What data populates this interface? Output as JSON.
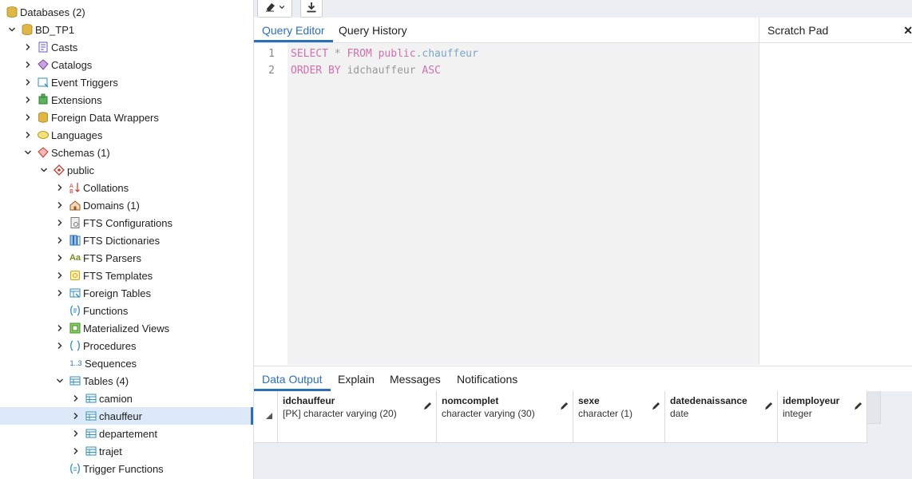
{
  "tree": {
    "items": [
      {
        "label": "Databases (2)",
        "icon": "databases-icon"
      },
      {
        "label": "BD_TP1",
        "icon": "database-icon"
      },
      {
        "label": "Casts",
        "icon": "casts-icon"
      },
      {
        "label": "Catalogs",
        "icon": "catalogs-icon"
      },
      {
        "label": "Event Triggers",
        "icon": "event-triggers-icon"
      },
      {
        "label": "Extensions",
        "icon": "extensions-icon"
      },
      {
        "label": "Foreign Data Wrappers",
        "icon": "foreign-data-wrappers-icon"
      },
      {
        "label": "Languages",
        "icon": "languages-icon"
      },
      {
        "label": "Schemas (1)",
        "icon": "schemas-icon"
      },
      {
        "label": "public",
        "icon": "schema-icon"
      },
      {
        "label": "Collations",
        "icon": "collations-icon"
      },
      {
        "label": "Domains (1)",
        "icon": "domains-icon"
      },
      {
        "label": "FTS Configurations",
        "icon": "fts-configurations-icon"
      },
      {
        "label": "FTS Dictionaries",
        "icon": "fts-dictionaries-icon"
      },
      {
        "label": "FTS Parsers",
        "icon": "fts-parsers-icon",
        "glyph": "Aa"
      },
      {
        "label": "FTS Templates",
        "icon": "fts-templates-icon"
      },
      {
        "label": "Foreign Tables",
        "icon": "foreign-tables-icon"
      },
      {
        "label": "Functions",
        "icon": "functions-icon"
      },
      {
        "label": "Materialized Views",
        "icon": "materialized-views-icon"
      },
      {
        "label": "Procedures",
        "icon": "procedures-icon"
      },
      {
        "label": "Sequences",
        "icon": "sequences-icon",
        "glyph": "1..3"
      },
      {
        "label": "Tables (4)",
        "icon": "tables-icon"
      },
      {
        "label": "camion",
        "icon": "table-icon"
      },
      {
        "label": "chauffeur",
        "icon": "table-icon"
      },
      {
        "label": "departement",
        "icon": "table-icon"
      },
      {
        "label": "trajet",
        "icon": "table-icon"
      },
      {
        "label": "Trigger Functions",
        "icon": "trigger-functions-icon"
      }
    ]
  },
  "editor": {
    "tabs": [
      "Query Editor",
      "Query History"
    ],
    "line_numbers": [
      "1",
      "2"
    ],
    "line1": {
      "kw1": "SELECT",
      "star": " * ",
      "kw2": "FROM",
      "schema": "public",
      "dot_table": ".chauffeur"
    },
    "line2": {
      "kw1": "ORDER BY",
      "col": " idchauffeur ",
      "kw2": "ASC"
    }
  },
  "scratch_pad": {
    "title": "Scratch Pad"
  },
  "output": {
    "tabs": [
      "Data Output",
      "Explain",
      "Messages",
      "Notifications"
    ],
    "columns": [
      {
        "name": "idchauffeur",
        "type": "[PK] character varying (20)"
      },
      {
        "name": "nomcomplet",
        "type": "character varying (30)"
      },
      {
        "name": "sexe",
        "type": "character (1)"
      },
      {
        "name": "datedenaissance",
        "type": "date"
      },
      {
        "name": "idemployeur",
        "type": "integer"
      }
    ]
  },
  "colors": {
    "accent": "#2c6fbb",
    "keyword": "#d46fad",
    "selected_row": "#dbe9f8"
  }
}
